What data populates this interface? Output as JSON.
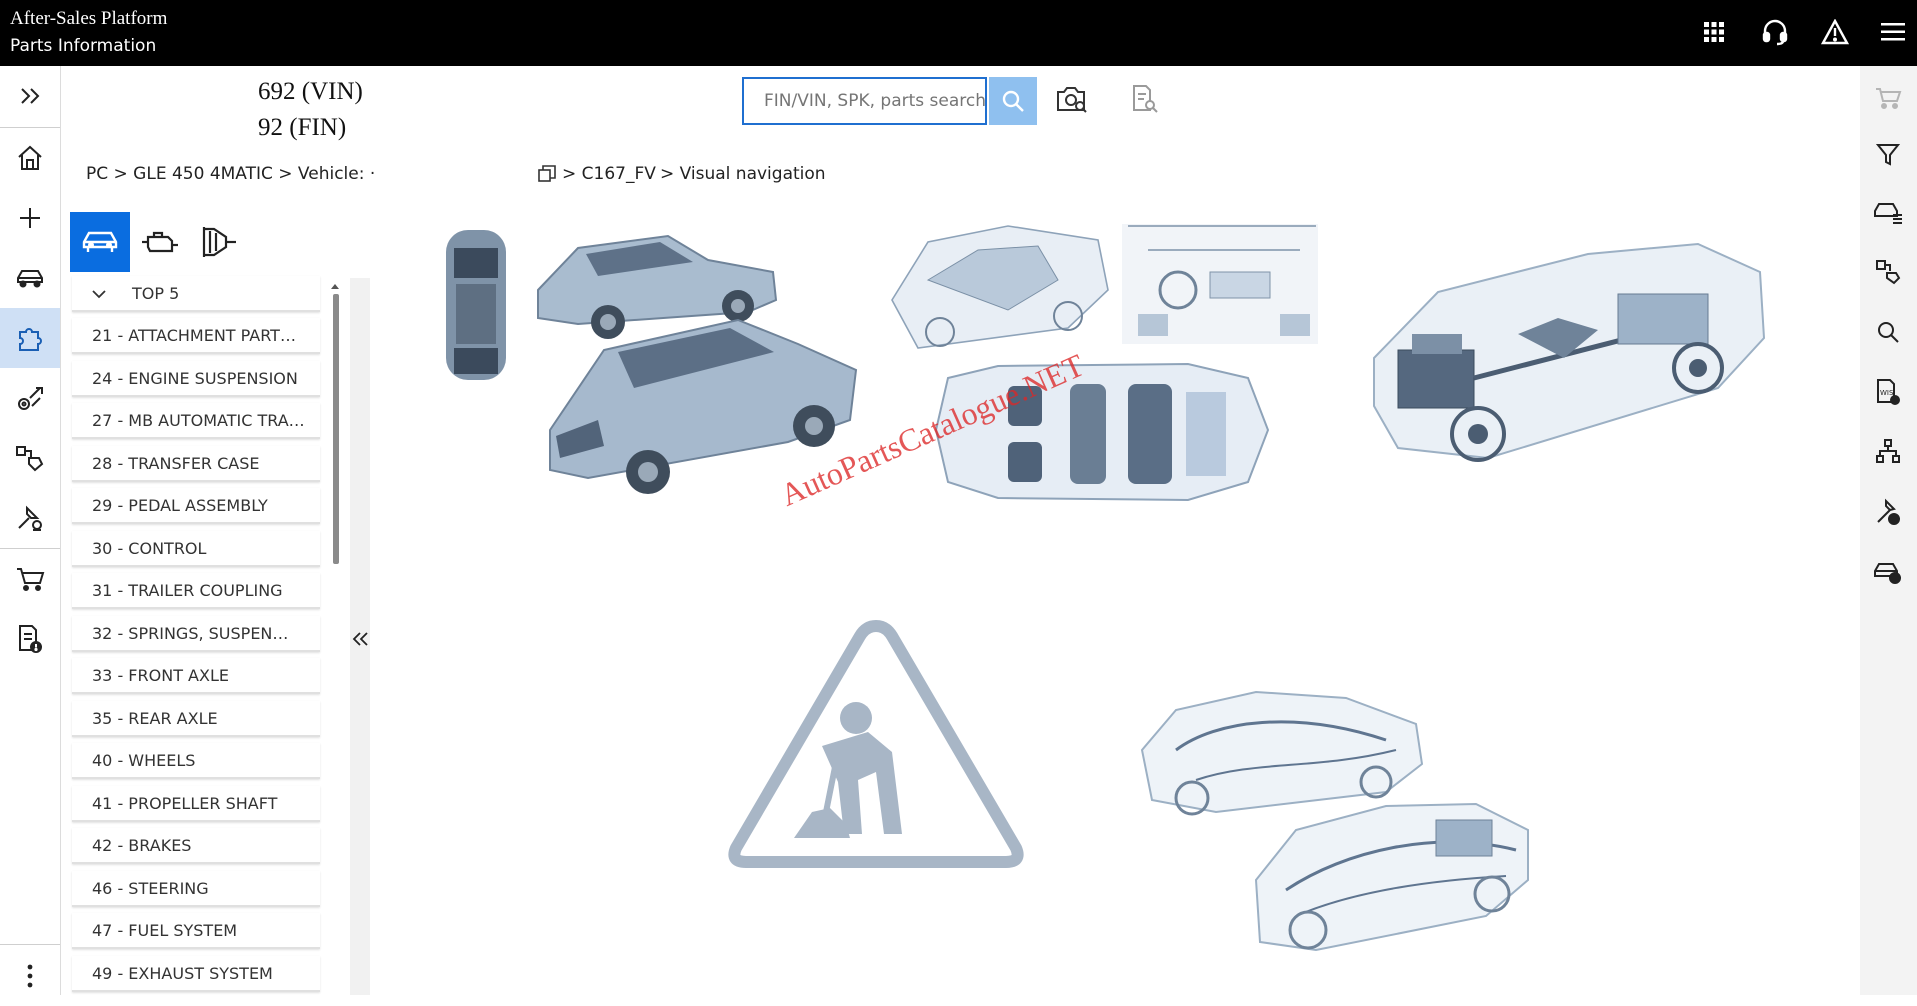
{
  "header": {
    "title": "After-Sales Platform",
    "subtitle": "Parts Information"
  },
  "vehicle": {
    "vin_line": "692 (VIN)",
    "fin_line": "92 (FIN)"
  },
  "search": {
    "placeholder": "FIN/VIN, SPK, parts search"
  },
  "breadcrumb": {
    "left": "PC > GLE 450 4MATIC > Vehicle: ·",
    "right_model": "> C167_FV",
    "right_view": "> Visual navigation"
  },
  "groups": {
    "top5_label": "TOP 5",
    "items": [
      "21 - ATTACHMENT PART…",
      "24 - ENGINE SUSPENSION",
      "27 - MB AUTOMATIC TRA…",
      "28 - TRANSFER CASE",
      "29 - PEDAL ASSEMBLY",
      "30 - CONTROL",
      "31 - TRAILER COUPLING",
      "32 - SPRINGS, SUSPEN…",
      "33 - FRONT AXLE",
      "35 - REAR AXLE",
      "40 - WHEELS",
      "41 - PROPELLER SHAFT",
      "42 - BRAKES",
      "46 - STEERING",
      "47 - FUEL SYSTEM",
      "49 - EXHAUST SYSTEM"
    ]
  },
  "watermark": "AutoPartsCatalogue.NET",
  "icons": {
    "topbar": [
      "apps-grid-icon",
      "headset-icon",
      "warning-icon",
      "menu-icon"
    ],
    "left_rail": [
      "expand-chevrons-icon",
      "home-icon",
      "plus-icon",
      "car-icon",
      "puzzle-icon",
      "parts-wrench-icon",
      "parts-tag-icon",
      "tools-icon",
      "cart-icon",
      "document-alert-icon",
      "more-vertical-icon"
    ],
    "right_rail": [
      "cart-icon",
      "filter-icon",
      "vehicle-list-icon",
      "parts-swap-icon",
      "search-icon",
      "wis-document-icon",
      "hierarchy-icon",
      "tools-check-icon",
      "vehicle-check-icon"
    ]
  },
  "colors": {
    "accent": "#0a6de0",
    "topbar": "#000000",
    "car_blue": "#9fb3c8",
    "watermark": "#dc2828"
  }
}
